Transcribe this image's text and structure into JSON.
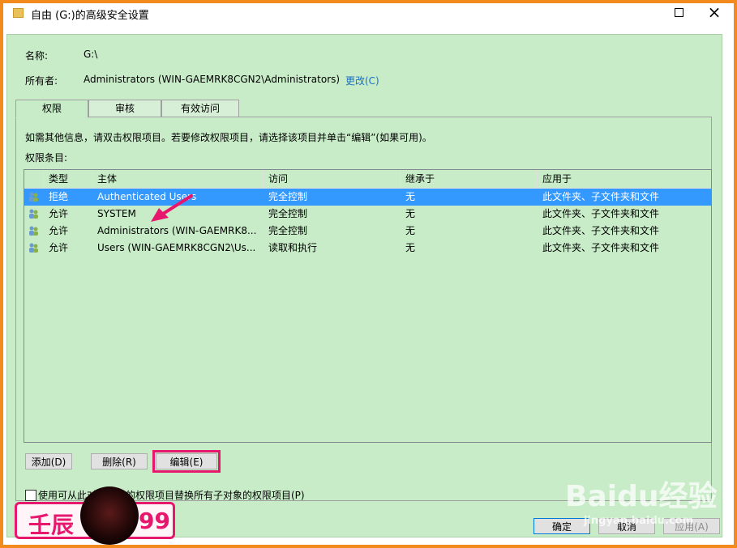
{
  "window": {
    "title": "自由 (G:)的高级安全设置"
  },
  "props": {
    "name_label": "名称:",
    "name_value": "G:\\",
    "owner_label": "所有者:",
    "owner_value": "Administrators (WIN-GAEMRK8CGN2\\Administrators)",
    "change_link": "更改(C)"
  },
  "tabs": [
    "权限",
    "审核",
    "有效访问"
  ],
  "info_text": "如需其他信息，请双击权限项目。若要修改权限项目，请选择该项目并单击“编辑”(如果可用)。",
  "entries_label": "权限条目:",
  "columns": [
    "类型",
    "主体",
    "访问",
    "继承于",
    "应用于"
  ],
  "rows": [
    {
      "type": "拒绝",
      "principal": "Authenticated Users",
      "access": "完全控制",
      "inherited": "无",
      "applies": "此文件夹、子文件夹和文件",
      "selected": true
    },
    {
      "type": "允许",
      "principal": "SYSTEM",
      "access": "完全控制",
      "inherited": "无",
      "applies": "此文件夹、子文件夹和文件",
      "selected": false
    },
    {
      "type": "允许",
      "principal": "Administrators (WIN-GAEMRK8...",
      "access": "完全控制",
      "inherited": "无",
      "applies": "此文件夹、子文件夹和文件",
      "selected": false
    },
    {
      "type": "允许",
      "principal": "Users (WIN-GAEMRK8CGN2\\Us...",
      "access": "读取和执行",
      "inherited": "无",
      "applies": "此文件夹、子文件夹和文件",
      "selected": false
    }
  ],
  "buttons": {
    "add": "添加(D)",
    "remove": "删除(R)",
    "edit": "编辑(E)",
    "ok": "确定",
    "cancel": "取消",
    "apply": "应用(A)"
  },
  "checkbox_label": "使用可从此对象继承的权限项目替换所有子对象的权限项目(P)",
  "watermarks": {
    "logo_left": "壬辰",
    "logo_right": "99",
    "baidu": "Baidu经验",
    "site": "jingyan.baidu.com"
  },
  "colors": {
    "frame": "#f28a1e",
    "panel": "#c8ecc8",
    "selection": "#3399ff",
    "annotation": "#e8176e",
    "link": "#1a6fc4"
  }
}
